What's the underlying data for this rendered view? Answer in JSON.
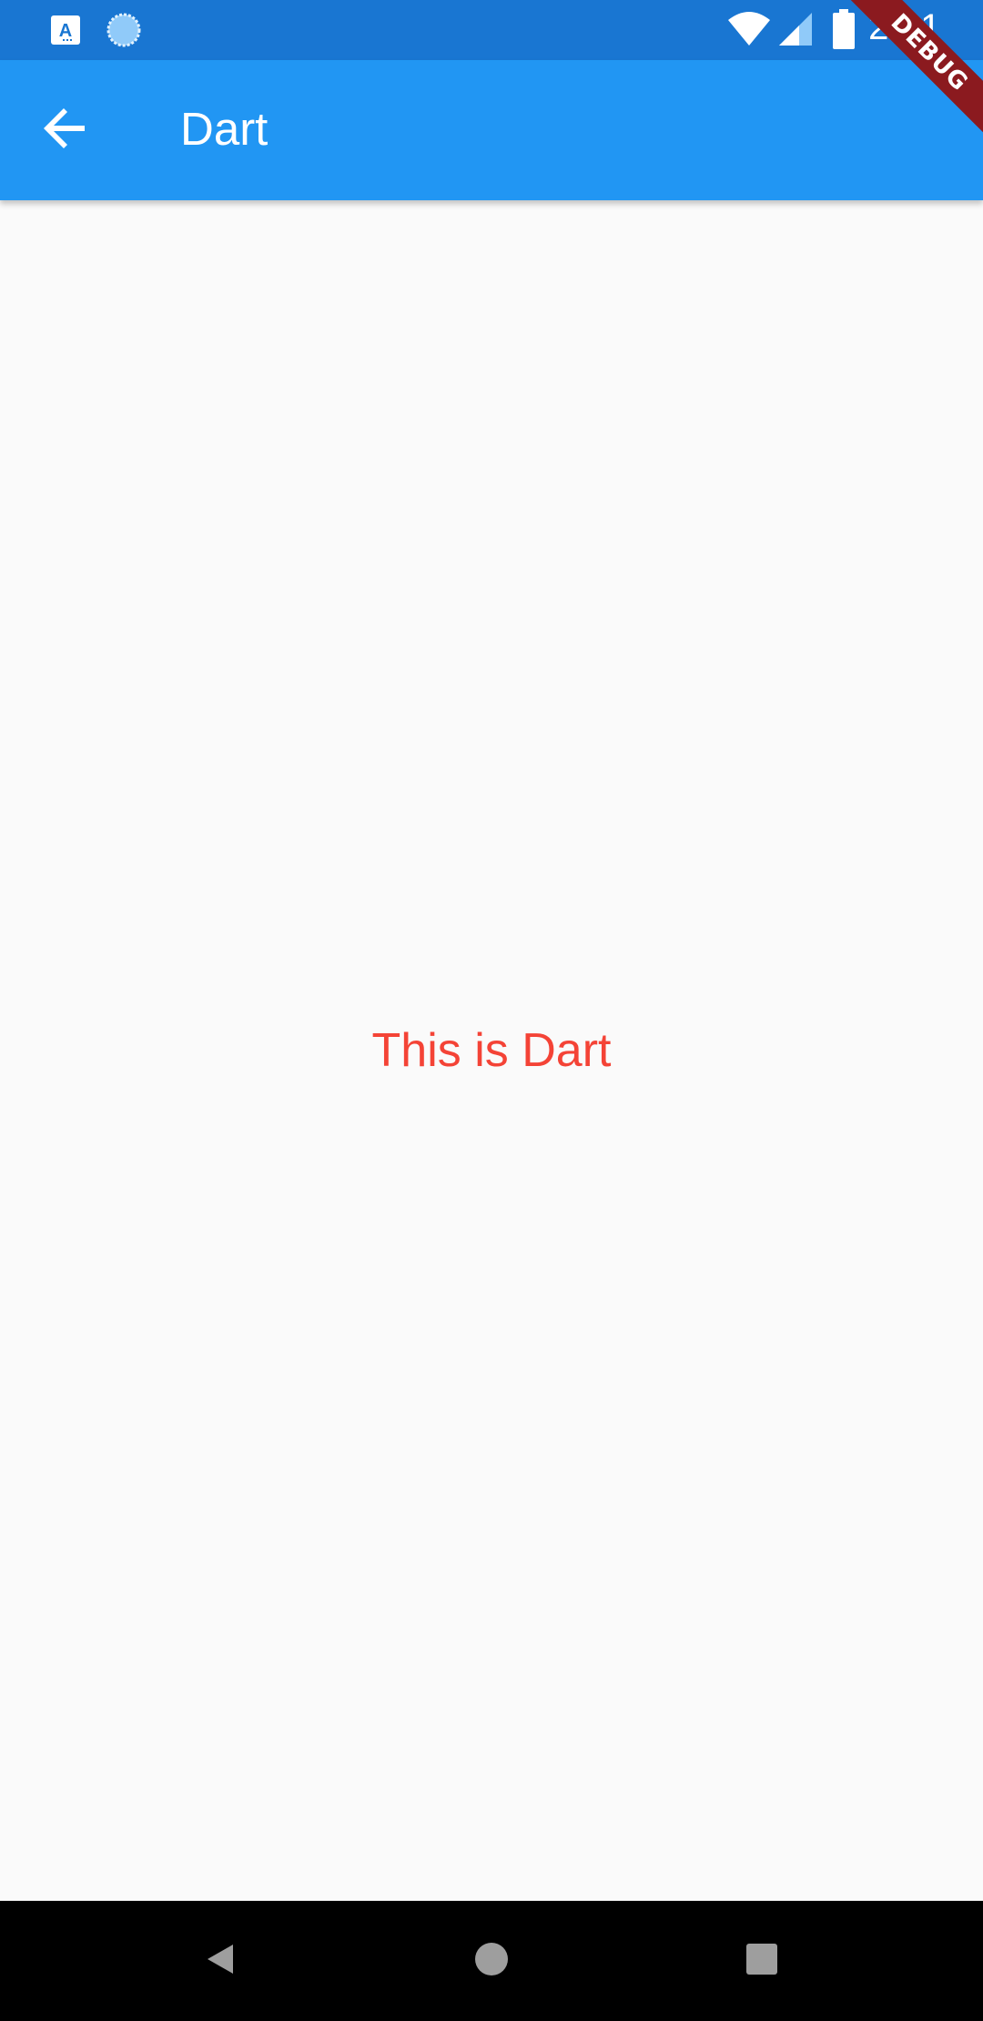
{
  "status_bar": {
    "time": "2:21",
    "left_icons": [
      "notification-app-icon",
      "sync-icon"
    ],
    "right_icons": [
      "wifi-icon",
      "cellular-signal-icon",
      "battery-icon"
    ],
    "background_color": "#1976d2"
  },
  "app_bar": {
    "title": "Dart",
    "back_icon": "arrow-back-icon",
    "background_color": "#2196f3"
  },
  "body": {
    "text": "This is Dart",
    "text_color": "#f44336",
    "background_color": "#fafafa"
  },
  "debug_banner": {
    "label": "DEBUG"
  },
  "nav_bar": {
    "buttons": [
      "back-triangle-icon",
      "home-circle-icon",
      "recents-square-icon"
    ]
  }
}
